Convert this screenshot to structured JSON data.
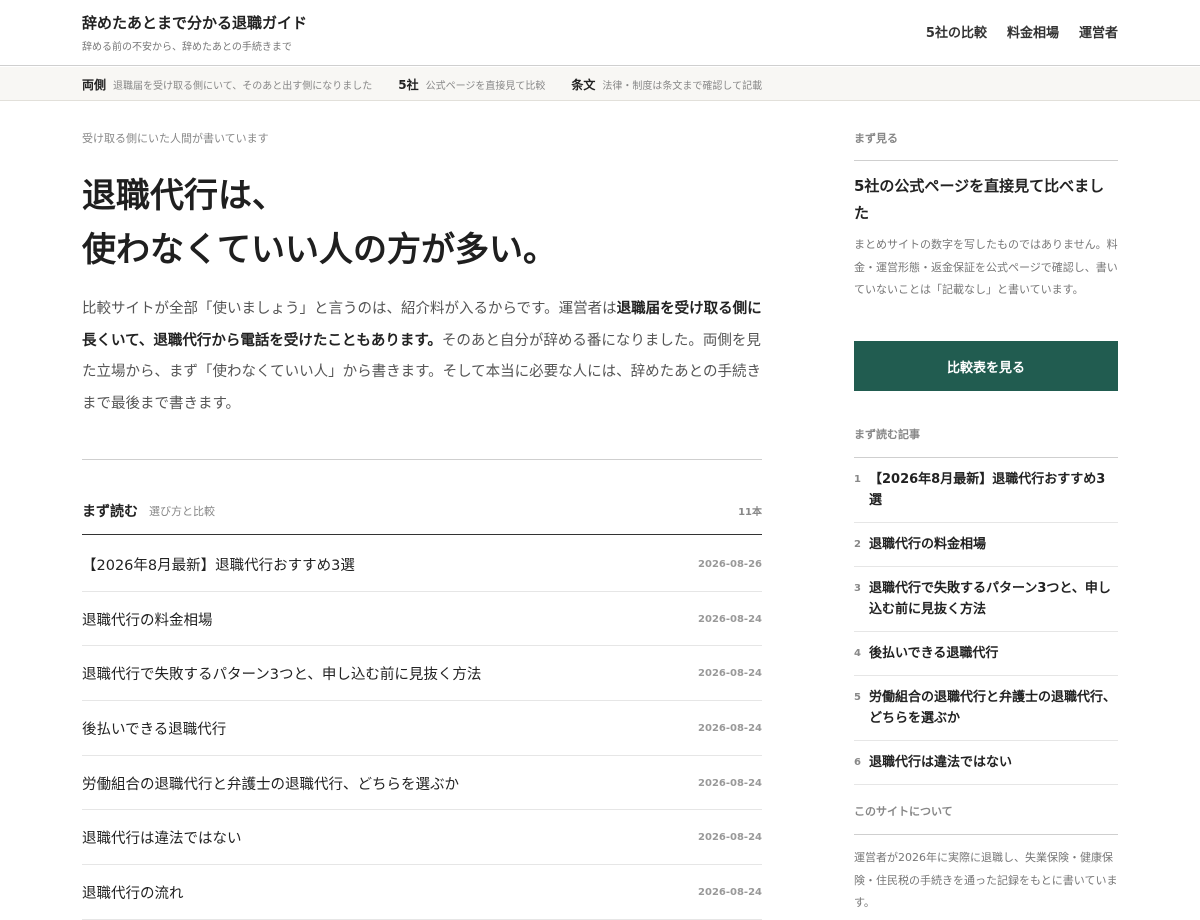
{
  "header": {
    "site_title": "辞めたあとまで分かる退職ガイド",
    "tagline": "辞める前の不安から、辞めたあとの手続きまで",
    "nav": [
      "5社の比較",
      "料金相場",
      "運営者"
    ]
  },
  "strip": [
    {
      "key": "両側",
      "text": "退職届を受け取る側にいて、そのあと出す側になりました"
    },
    {
      "key": "5社",
      "text": "公式ページを直接見て比較"
    },
    {
      "key": "条文",
      "text": "法律・制度は条文まで確認して記載"
    }
  ],
  "main": {
    "eyebrow": "受け取る側にいた人間が書いています",
    "headline_line1": "退職代行は、",
    "headline_line2": "使わなくていい人の方が多い。",
    "intro_part1": "比較サイトが全部「使いましょう」と言うのは、紹介料が入るからです。運営者は",
    "intro_bold": "退職届を受け取る側に長くいて、退職代行から電話を受けたこともあります。",
    "intro_part2": "そのあと自分が辞める番になりました。両側を見た立場から、まず「使わなくていい人」から書きます。そして本当に必要な人には、辞めたあとの手続きまで最後まで書きます。",
    "list_title": "まず読む",
    "list_subtitle": "選び方と比較",
    "list_count": "11本",
    "articles": [
      {
        "title": "【2026年8月最新】退職代行おすすめ3選",
        "date": "2026-08-26"
      },
      {
        "title": "退職代行の料金相場",
        "date": "2026-08-24"
      },
      {
        "title": "退職代行で失敗するパターン3つと、申し込む前に見抜く方法",
        "date": "2026-08-24"
      },
      {
        "title": "後払いできる退職代行",
        "date": "2026-08-24"
      },
      {
        "title": "労働組合の退職代行と弁護士の退職代行、どちらを選ぶか",
        "date": "2026-08-24"
      },
      {
        "title": "退職代行は違法ではない",
        "date": "2026-08-24"
      },
      {
        "title": "退職代行の流れ",
        "date": "2026-08-24"
      }
    ]
  },
  "sidebar": {
    "first_label": "まず見る",
    "heading": "5社の公式ページを直接見て比べました",
    "description": "まとめサイトの数字を写したものではありません。料金・運営形態・返金保証を公式ページで確認し、書いていないことは「記載なし」と書いています。",
    "cta_label": "比較表を見る",
    "read_first_label": "まず読む記事",
    "read_first": [
      {
        "num": "1",
        "title": "【2026年8月最新】退職代行おすすめ3選"
      },
      {
        "num": "2",
        "title": "退職代行の料金相場"
      },
      {
        "num": "3",
        "title": "退職代行で失敗するパターン3つと、申し込む前に見抜く方法"
      },
      {
        "num": "4",
        "title": "後払いできる退職代行"
      },
      {
        "num": "5",
        "title": "労働組合の退職代行と弁護士の退職代行、どちらを選ぶか"
      },
      {
        "num": "6",
        "title": "退職代行は違法ではない"
      }
    ],
    "about_label": "このサイトについて",
    "about_text": "運営者が2026年に実際に退職し、失業保険・健康保険・住民税の手続きを通った記録をもとに書いています。"
  }
}
